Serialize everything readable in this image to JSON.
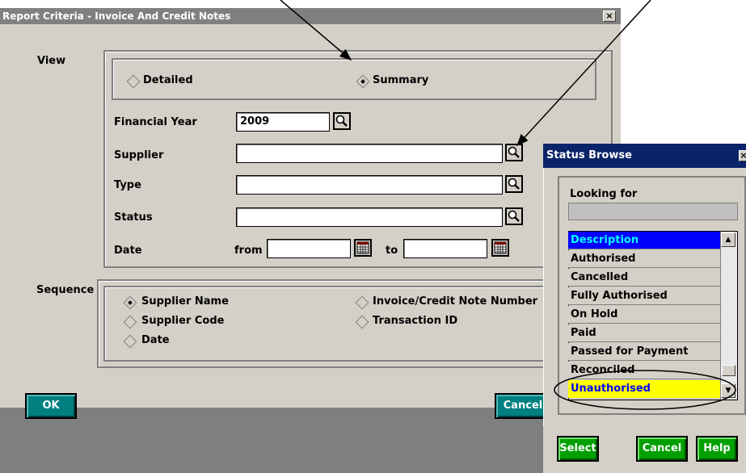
{
  "main_dialog": {
    "title": "Report Criteria - Invoice And Credit Notes",
    "close_label": "×",
    "view_label": "View",
    "view_options": {
      "detailed": "Detailed",
      "summary": "Summary"
    },
    "financial_year_label": "Financial Year",
    "financial_year_value": "2009",
    "supplier_label": "Supplier",
    "type_label": "Type",
    "status_label": "Status",
    "date_label": "Date",
    "from_label": "from",
    "to_label": "to",
    "sequence_label": "Sequence",
    "sequence_options": {
      "supplier_name": "Supplier Name",
      "supplier_code": "Supplier Code",
      "date": "Date",
      "invoice_number": "Invoice/Credit Note Number",
      "transaction_id": "Transaction ID"
    },
    "ok_label": "OK",
    "cancel_label": "Cancel"
  },
  "status_browse": {
    "title": "Status Browse",
    "close_label": "×",
    "looking_for_label": "Looking for",
    "header": "Description",
    "items": [
      "Authorised",
      "Cancelled",
      "Fully Authorised",
      "On Hold",
      "Paid",
      "Passed for Payment",
      "Reconciled",
      "Unauthorised"
    ],
    "select_label": "Select",
    "cancel_label": "Cancel",
    "help_label": "Help"
  },
  "colors": {
    "title_bar": "#808080",
    "browse_title": "#0a246a",
    "button_teal": "#008080",
    "button_green": "#00a000",
    "highlight_blue": "#0000ff",
    "highlight_yellow": "#ffff00"
  }
}
